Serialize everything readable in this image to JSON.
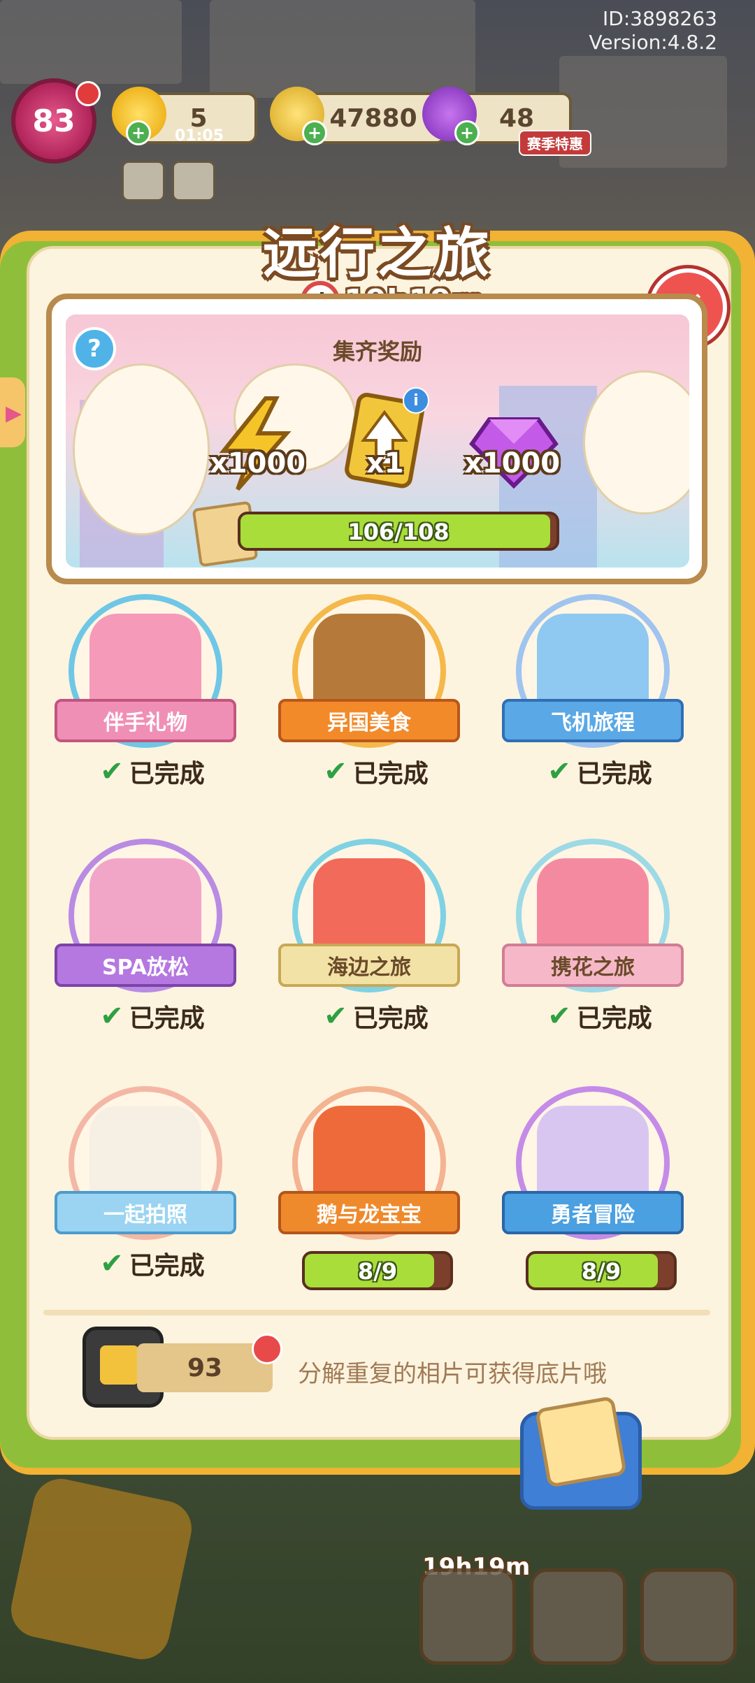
{
  "header": {
    "id_text": "ID:3898263",
    "version_text": "Version:4.8.2"
  },
  "top_bar": {
    "level": "83",
    "energy": "5",
    "energy_timer": "01:05",
    "coins": "47880",
    "gems": "48",
    "season_badge": "赛季特惠"
  },
  "panel": {
    "title": "远行之旅",
    "timer": "19h19m",
    "banner_label": "集齐奖励",
    "rewards": [
      {
        "icon": "lightning-icon",
        "qty": "x1000",
        "color": "#f5c428"
      },
      {
        "icon": "upgrade-card-icon",
        "qty": "x1",
        "color": "#f2c63a"
      },
      {
        "icon": "gem-icon",
        "qty": "x1000",
        "color": "#c45be8"
      }
    ],
    "progress_text": "106/108",
    "progress_value": 0.98
  },
  "albums": [
    {
      "name": "伴手礼物",
      "status": "已完成",
      "ribbon": "#f08fb6",
      "ribbon_border": "#c2557f",
      "ring": "#6fc7e6",
      "art": "#f59ab9"
    },
    {
      "name": "异国美食",
      "status": "已完成",
      "ribbon": "#f28a2a",
      "ribbon_border": "#b9561a",
      "ring": "#f5b84b",
      "art": "#b57a3a"
    },
    {
      "name": "飞机旅程",
      "status": "已完成",
      "ribbon": "#5aa8e6",
      "ribbon_border": "#2f6fb3",
      "ring": "#9fc4ef",
      "art": "#8fc8f0"
    },
    {
      "name": "SPA放松",
      "status": "已完成",
      "ribbon": "#b577e0",
      "ribbon_border": "#7d43a8",
      "ring": "#b98be3",
      "art": "#f2a6c7"
    },
    {
      "name": "海边之旅",
      "status": "已完成",
      "ribbon": "#f3e2a6",
      "ribbon_border": "#c8a856",
      "ring": "#7fd2e3",
      "art": "#f26a5a",
      "dark_text": true
    },
    {
      "name": "携花之旅",
      "status": "已完成",
      "ribbon": "#f6b8c8",
      "ribbon_border": "#d27c95",
      "ring": "#9ed9e6",
      "art": "#f48aa0",
      "dark_text": true
    },
    {
      "name": "一起拍照",
      "status": "已完成",
      "ribbon": "#9ad4f2",
      "ribbon_border": "#4c9ccc",
      "ring": "#f4b7a6",
      "art": "#f6efe4"
    },
    {
      "name": "鹅与龙宝宝",
      "status": "",
      "progress": "8/9",
      "progress_value": 0.89,
      "ribbon": "#ef8a2c",
      "ribbon_border": "#b5541a",
      "ring": "#f4b391",
      "art": "#ef6a3a"
    },
    {
      "name": "勇者冒险",
      "status": "",
      "progress": "8/9",
      "progress_value": 0.89,
      "ribbon": "#4aa0e0",
      "ribbon_border": "#2a66a8",
      "ring": "#c58be8",
      "art": "#d9c6f0"
    }
  ],
  "footer": {
    "film_count": "93",
    "hint": "分解重复的相片可获得底片哦"
  },
  "bottom_hud": {
    "timer": "19h19m"
  }
}
